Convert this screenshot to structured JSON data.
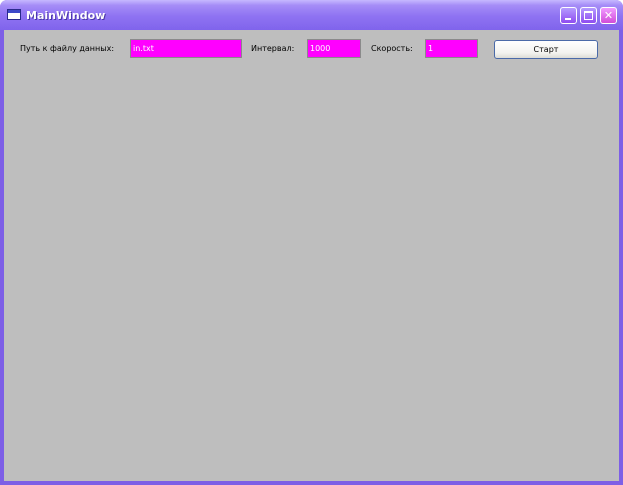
{
  "window": {
    "title": "MainWindow",
    "accent_color": "#8064ec",
    "field_color": "#ff00ff"
  },
  "controls": {
    "path_label": "Путь к файлу данных:",
    "path_value": "in.txt",
    "interval_label": "Интервал:",
    "interval_value": "1000",
    "speed_label": "Скорость:",
    "speed_value": "1",
    "start_label": "Старт"
  },
  "icons": {
    "app": "window-icon",
    "minimize": "minimize-icon",
    "maximize": "maximize-icon",
    "close": "close-icon"
  }
}
